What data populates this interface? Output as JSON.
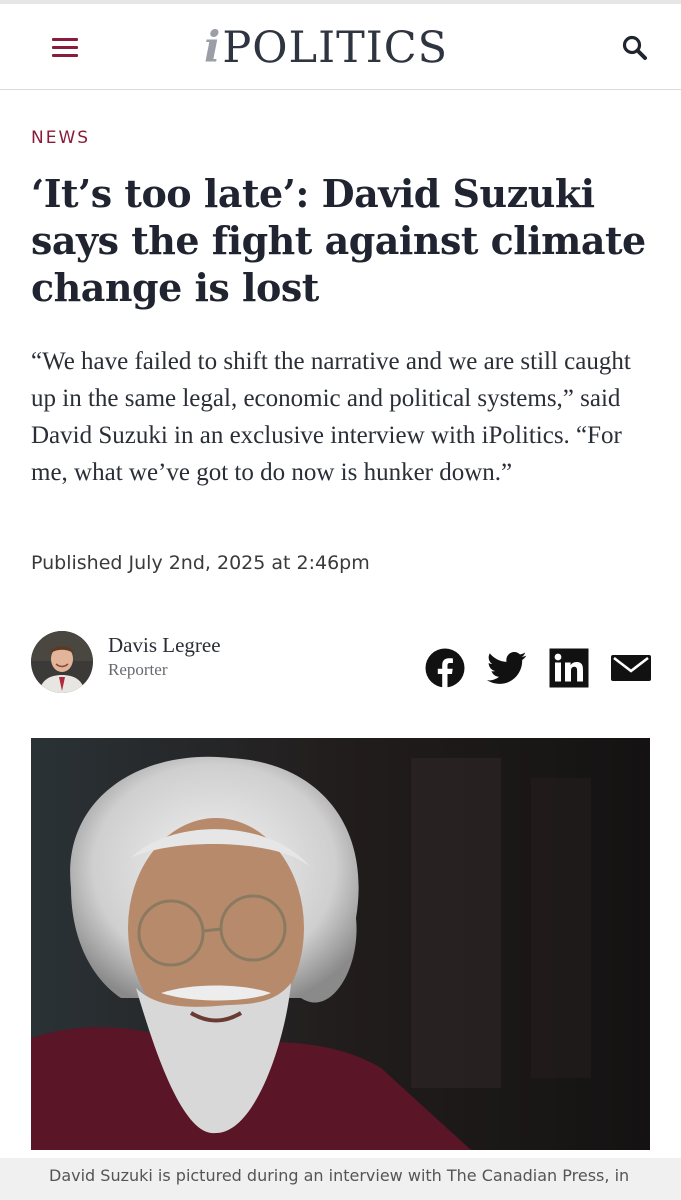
{
  "header": {
    "logo_prefix": "i",
    "logo_text": "POLITICS",
    "menu_icon": "hamburger-menu-icon",
    "search_icon": "search-icon",
    "brand_color": "#8a1c3b"
  },
  "article": {
    "section": "NEWS",
    "headline": "‘It’s too late’: David Suzuki says the fight against climate change is lost",
    "dek": "“We have failed to shift the narrative and we are still caught up in the same legal, economic and political systems,” said David Suzuki in an exclusive interview with iPolitics. “For me, what we’ve got to do now is hunker down.”",
    "published": "Published July 2nd, 2025 at 2:46pm",
    "author": {
      "name": "Davis Legree",
      "role": "Reporter"
    },
    "share": [
      {
        "icon": "facebook-icon"
      },
      {
        "icon": "twitter-icon"
      },
      {
        "icon": "linkedin-icon"
      },
      {
        "icon": "email-icon"
      }
    ],
    "caption": "David Suzuki is pictured during an interview with The Canadian Press, in"
  }
}
